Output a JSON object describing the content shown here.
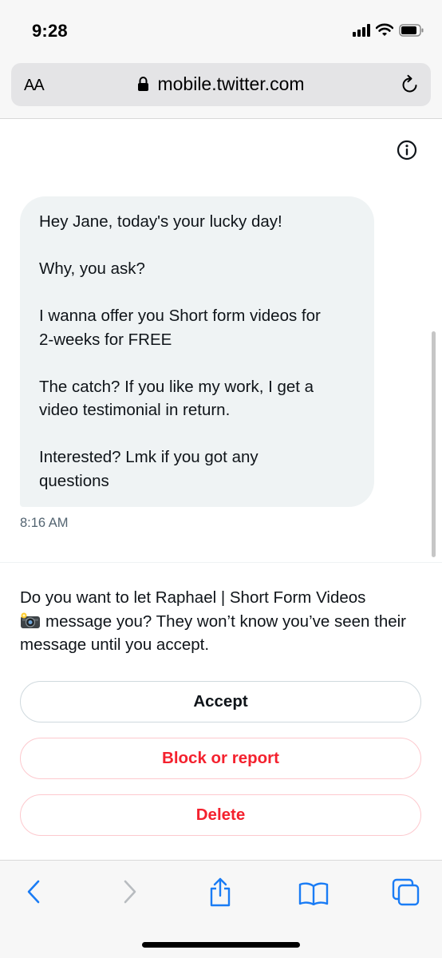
{
  "status_bar": {
    "time": "9:28"
  },
  "browser": {
    "text_size_label": "AA",
    "url": "mobile.twitter.com"
  },
  "conversation": {
    "message_paragraphs": [
      "Hey Jane, today's your lucky day!",
      "Why, you ask?",
      "I wanna offer you Short form videos for\n2-weeks for FREE",
      "The catch? If you like my work, I get a\nvideo testimonial in return.",
      "Interested? Lmk if you got any\nquestions"
    ],
    "timestamp": "8:16 AM"
  },
  "request": {
    "prompt_part1": "Do you want to let Raphael | Short Form Videos",
    "prompt_emoji": "camera-flash-emoji",
    "prompt_part2": "message you? They won’t know you’ve seen their message until you accept.",
    "accept_label": "Accept",
    "block_label": "Block or report",
    "delete_label": "Delete"
  },
  "colors": {
    "accent_blue": "#1d9bf0",
    "danger_red": "#f4212e",
    "bubble_bg": "#eff3f4",
    "secondary_text": "#536471"
  },
  "icons": {
    "lock": "lock-icon",
    "reload": "reload-icon",
    "info": "info-icon",
    "back": "chevron-left-icon",
    "forward": "chevron-right-icon",
    "share": "share-icon",
    "bookmarks": "book-icon",
    "tabs": "tabs-icon"
  }
}
